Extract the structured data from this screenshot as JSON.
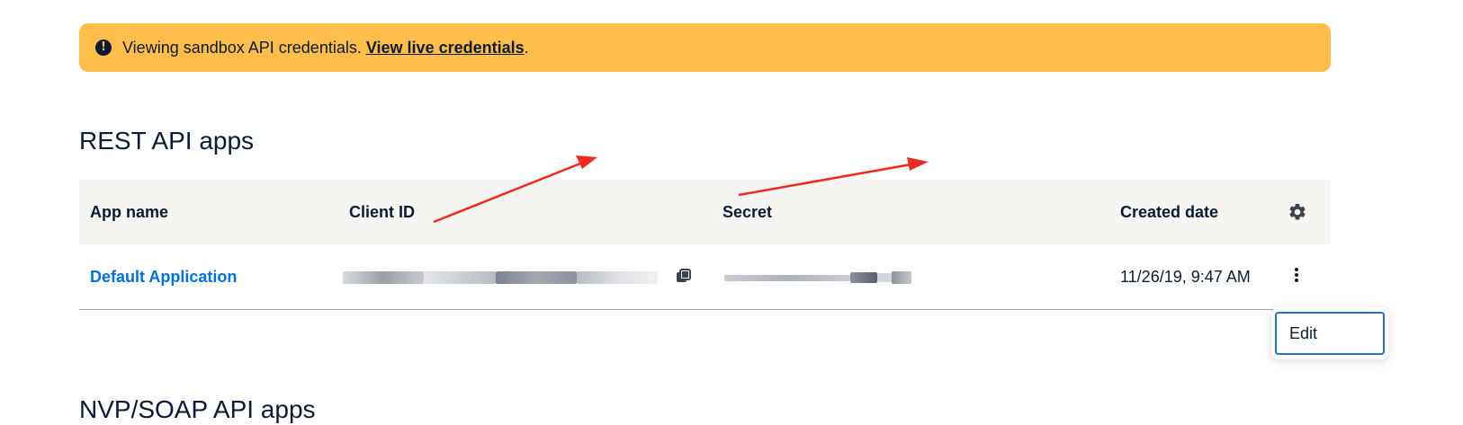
{
  "banner": {
    "icon": "exclamation-circle-icon",
    "text": "Viewing sandbox API credentials.",
    "link_label": "View live credentials",
    "suffix": ".",
    "color": "#ffbe4a"
  },
  "rest_section": {
    "title": "REST API apps",
    "columns": [
      "App name",
      "Client ID",
      "Secret",
      "Created date"
    ],
    "settings_icon": "gear-icon",
    "rows": [
      {
        "app_name": "Default Application",
        "client_id": "[redacted]",
        "secret": "[redacted]",
        "created_date": "11/26/19, 9:47 AM"
      }
    ]
  },
  "row_menu": {
    "items": [
      "Edit"
    ]
  },
  "nvp_section": {
    "title": "NVP/SOAP API apps"
  },
  "colors": {
    "link": "#0070e0",
    "text": "#0b1b33",
    "header_bg": "#f7f5f2",
    "annotation_arrow": "#ee2a1e"
  }
}
